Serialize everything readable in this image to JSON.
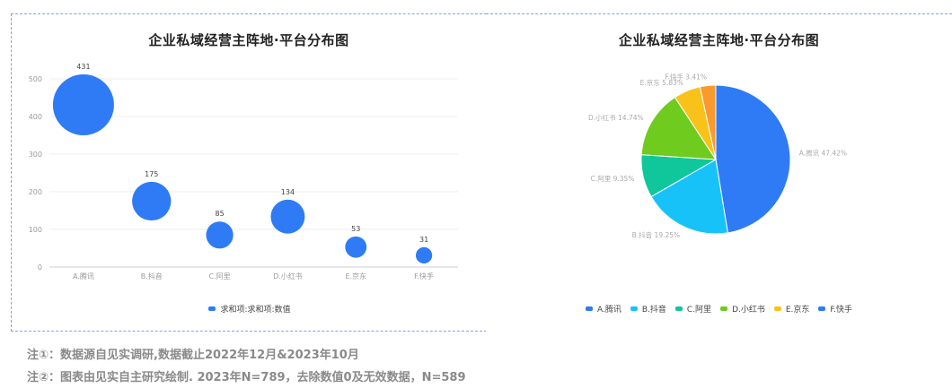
{
  "notes": {
    "note1": "注①：数据源自见实调研,数据截止2022年12月&2023年10月",
    "note2": "注②：图表由见实自主研究绘制. 2023年N=789，去除数值0及无效数据，N=589"
  },
  "chart_data": [
    {
      "type": "scatter",
      "subtype": "bubble",
      "title": "企业私域经营主阵地·平台分布图",
      "categories": [
        "A.腾讯",
        "B.抖音",
        "C.阿里",
        "D.小红书",
        "E.京东",
        "F.快手"
      ],
      "series": [
        {
          "name": "求和项:求和项:数值",
          "values": [
            431,
            175,
            85,
            134,
            53,
            31
          ],
          "color": "#2f7bf5"
        }
      ],
      "ylim": [
        0,
        500
      ],
      "yticks": [
        0,
        100,
        200,
        300,
        400,
        500
      ],
      "grid": true,
      "legend_position": "bottom"
    },
    {
      "type": "pie",
      "title": "企业私域经营主阵地·平台分布图",
      "slices": [
        {
          "label": "A.腾讯",
          "value": 47.42,
          "display": "A.腾讯 47.42%",
          "color": "#2f7bf5"
        },
        {
          "label": "B.抖音",
          "value": 19.25,
          "display": "B.抖音 19.25%",
          "color": "#17c2f8"
        },
        {
          "label": "C.阿里",
          "value": 9.35,
          "display": "C.阿里 9.35%",
          "color": "#0fc79a"
        },
        {
          "label": "D.小红书",
          "value": 14.74,
          "display": "D.小红书 14.74%",
          "color": "#6fcb1e"
        },
        {
          "label": "E.京东",
          "value": 5.83,
          "display": "E.京东 5.83%",
          "color": "#f8c21b"
        },
        {
          "label": "F.快手",
          "value": 3.41,
          "display": "F.快手 3.41%",
          "color": "#fa9a2e"
        }
      ],
      "legend": [
        {
          "label": "A.腾讯",
          "color": "#2f7bf5"
        },
        {
          "label": "B.抖音",
          "color": "#17c2f8"
        },
        {
          "label": "C.阿里",
          "color": "#0fc79a"
        },
        {
          "label": "D.小红书",
          "color": "#6fcb1e"
        },
        {
          "label": "E.京东",
          "color": "#f8c21b"
        },
        {
          "label": "F.快手",
          "color": "#2f7bf5"
        }
      ],
      "legend_position": "bottom"
    }
  ]
}
